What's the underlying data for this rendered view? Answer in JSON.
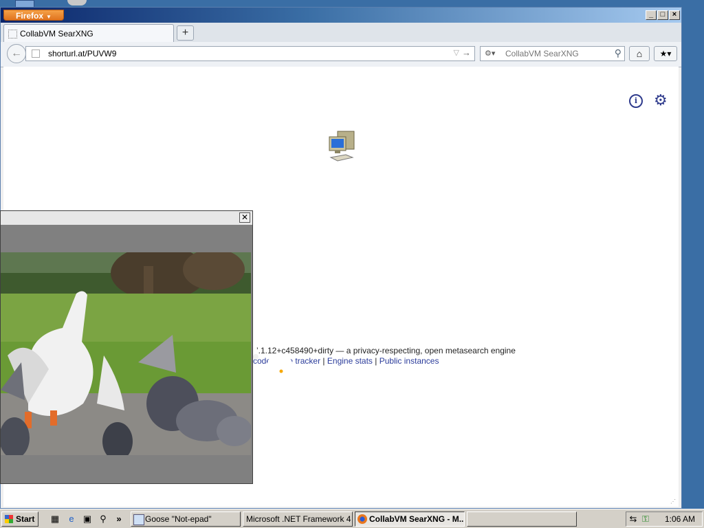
{
  "browser": {
    "menu_button": "Firefox",
    "tab_title": "CollabVM SearXNG",
    "new_tab": "+",
    "url": "shorturl.at/PUVW9",
    "search_placeholder": "CollabVM SearXNG"
  },
  "page": {
    "footer_text": "’.1.12+c458490+dirty — a privacy-respecting, open metasearch engine",
    "links": {
      "source": "code",
      "issue": "Issue tracker",
      "stats": "Engine stats",
      "instances": "Public instances"
    },
    "separator": "|"
  },
  "taskbar": {
    "start": "Start",
    "more": "»",
    "tasks": [
      {
        "label": "Goose \"Not-epad\""
      },
      {
        "label": "Microsoft .NET Framework 4 ..."
      },
      {
        "label": "CollabVM SearXNG - M..."
      }
    ],
    "clock": "1:06 AM"
  },
  "colors": {
    "accent": "#2e3a8c",
    "link": "#2a3b9a",
    "desktop": "#3a6ea5"
  }
}
